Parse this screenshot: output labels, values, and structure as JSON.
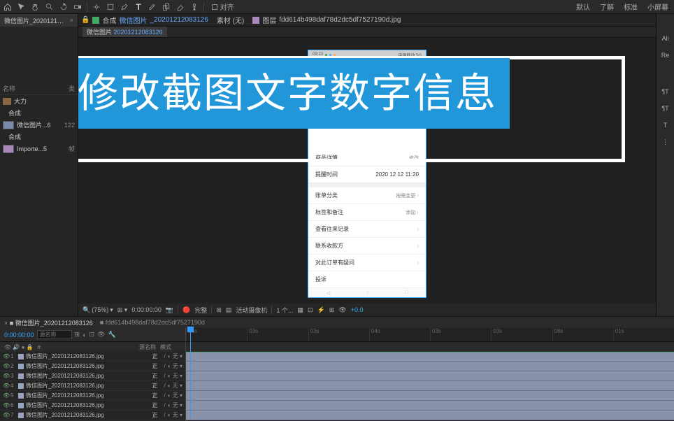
{
  "toolbar": {
    "snap_label": "口 对齐",
    "menu_default": "默认",
    "menu_learn": "了解",
    "menu_std": "标准",
    "menu_screen": "小屏幕"
  },
  "center_tabs": {
    "comp_prefix": "合成",
    "comp_name": "微信图片",
    "comp_suffix": "_20201212083126",
    "layer_prefix": "素材 (无)",
    "footage_prefix": "图层",
    "footage_name": "fdd614b498daf78d2dc5df7527190d.jpg"
  },
  "sub_tab": {
    "label": "微信图片",
    "suffix": "20201212083126"
  },
  "left_panel": {
    "tab": "微信图片_20201212083126",
    "col_name": "名称",
    "col_type": "类",
    "items": [
      {
        "name": "大力",
        "type_label": ""
      },
      {
        "name": "合成",
        "type_label": ""
      },
      {
        "name": "微信图片...6",
        "type_label": "122"
      },
      {
        "name": "合成",
        "type_label": ""
      },
      {
        "name": "Importe...5",
        "type_label": "帧"
      }
    ]
  },
  "banner": "修改截图文字数字信息",
  "phone": {
    "status_time": "09:23",
    "status_right": "中国移动 5G",
    "row_shop": {
      "label": "商品详情",
      "value": "修改"
    },
    "row_time": {
      "label": "提醒时间",
      "value": "2020 12 12 11:20"
    },
    "row_cat": {
      "label": "账单分类",
      "value": "按需变更"
    },
    "row_tag": {
      "label": "标签和备注",
      "value": "添加"
    },
    "row_hist": {
      "label": "查看往来记录"
    },
    "row_contact": {
      "label": "联系收款方"
    },
    "row_question": {
      "label": "对此订单有疑问"
    },
    "row_complain": {
      "label": "投诉"
    }
  },
  "viewer_controls": {
    "zoom": "(75%)",
    "time": "0:00:00:00",
    "full": "完整",
    "motion": "活动摄像机",
    "view": "1 个...",
    "exposure": "+0.0"
  },
  "right_tabs": [
    "Ali",
    "Re"
  ],
  "right_icons": [
    "¶T",
    "¶T",
    "T",
    "⋮"
  ],
  "timeline": {
    "tab1": "微信图片_20201212083126",
    "tab2": "fdd614b498daf78d2dc5df7527190d",
    "current_time": "0:00:00:00",
    "search_ph": "源名称",
    "marks": [
      "05s",
      "03s",
      "03s",
      "04s",
      "03s",
      "03s",
      "08s",
      "01s"
    ],
    "col_header": "模式",
    "layers": [
      {
        "name": "微信图片_20201212083126.jpg",
        "mode": "正",
        "dd": "无"
      },
      {
        "name": "微信图片_20201212083126.jpg",
        "mode": "正",
        "dd": "无"
      },
      {
        "name": "微信图片_20201212083126.jpg",
        "mode": "正",
        "dd": "无"
      },
      {
        "name": "微信图片_20201212083126.jpg",
        "mode": "正",
        "dd": "无"
      },
      {
        "name": "微信图片_20201212083126.jpg",
        "mode": "正",
        "dd": "无"
      },
      {
        "name": "微信图片_20201212083126.jpg",
        "mode": "正",
        "dd": "无"
      },
      {
        "name": "微信图片_20201212083126.jpg",
        "mode": "正",
        "dd": "无"
      }
    ]
  }
}
